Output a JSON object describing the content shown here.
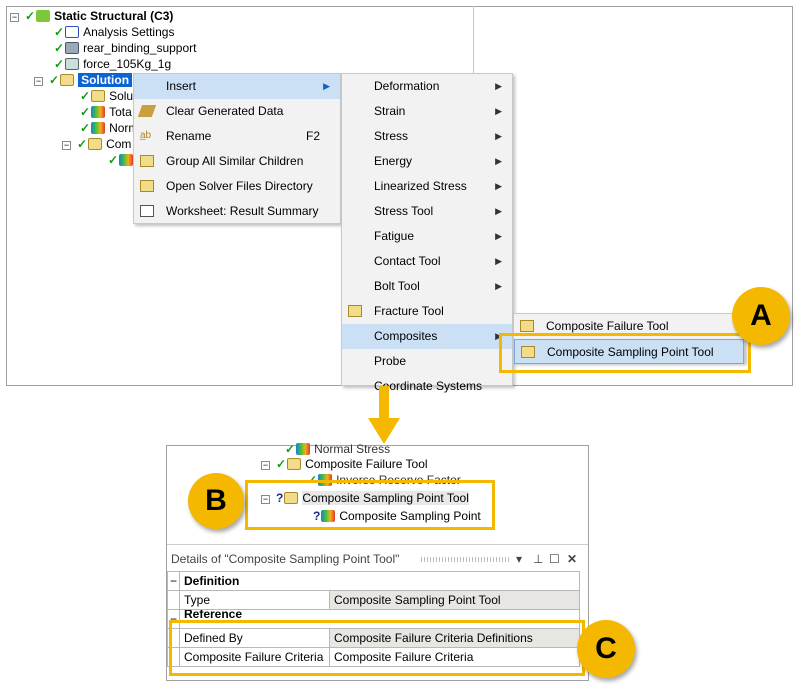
{
  "tree": {
    "root": "Static Structural (C3)",
    "children": [
      "Analysis Settings",
      "rear_binding_support",
      "force_105Kg_1g"
    ],
    "solution": "Solution",
    "solution_children": [
      "Solu",
      "Tota",
      "Norm",
      "Com"
    ]
  },
  "context_menu": {
    "items": [
      {
        "label": "Insert"
      },
      {
        "label": "Clear Generated Data"
      },
      {
        "label": "Rename",
        "shortcut": "F2"
      },
      {
        "label": "Group All Similar Children"
      },
      {
        "label": "Open Solver Files Directory"
      },
      {
        "label": "Worksheet: Result Summary"
      }
    ]
  },
  "insert_menu": {
    "items": [
      "Deformation",
      "Strain",
      "Stress",
      "Energy",
      "Linearized Stress",
      "Stress Tool",
      "Fatigue",
      "Contact Tool",
      "Bolt Tool",
      "Fracture Tool",
      "Composites",
      "Probe",
      "Coordinate Systems"
    ]
  },
  "composites_menu": {
    "items": [
      "Composite Failure Tool",
      "Composite Sampling Point Tool"
    ]
  },
  "callouts": {
    "a": "A",
    "b": "B",
    "c": "C"
  },
  "tree2": {
    "items": [
      "Normal Stress",
      "Composite Failure Tool",
      "Inverse Reserve Factor",
      "Composite Sampling Point Tool",
      "Composite Sampling Point"
    ]
  },
  "details": {
    "title": "Details of \"Composite Sampling Point Tool\"",
    "sections": [
      {
        "name": "Definition"
      },
      {
        "name": "Reference"
      }
    ],
    "rows": [
      {
        "label": "Type",
        "value": "Composite Sampling Point Tool"
      },
      {
        "label": "Defined By",
        "value": "Composite Failure Criteria Definitions"
      },
      {
        "label": "Composite Failure Criteria",
        "value": "Composite Failure Criteria"
      }
    ]
  },
  "colors": {
    "highlight": "#f5b800",
    "menu_hover": "#cce0f5",
    "selection": "#0a64d6"
  }
}
